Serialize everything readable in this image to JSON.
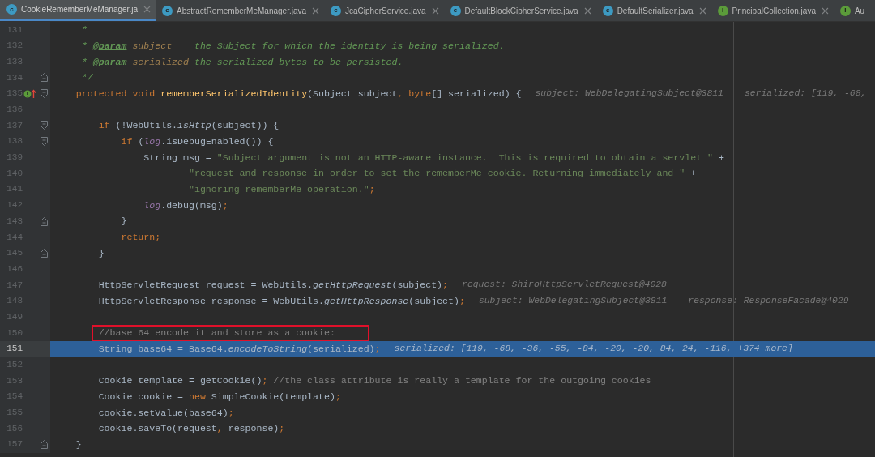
{
  "tabs": [
    {
      "label": "CookieRememberMeManager.ja",
      "kind": "class",
      "letter": "c",
      "selected": true
    },
    {
      "label": "AbstractRememberMeManager.java",
      "kind": "class",
      "letter": "c",
      "selected": false
    },
    {
      "label": "JcaCipherService.java",
      "kind": "class",
      "letter": "c",
      "selected": false
    },
    {
      "label": "DefaultBlockCipherService.java",
      "kind": "class",
      "letter": "c",
      "selected": false
    },
    {
      "label": "DefaultSerializer.java",
      "kind": "class",
      "letter": "c",
      "selected": false
    },
    {
      "label": "PrincipalCollection.java",
      "kind": "interface",
      "letter": "I",
      "selected": false
    },
    {
      "label": "Au",
      "kind": "interface",
      "letter": "I",
      "selected": false
    }
  ],
  "lines": [
    {
      "number": "131",
      "current": false,
      "boxed": false,
      "segments": [
        {
          "kind": "doc",
          "text": "     *"
        }
      ]
    },
    {
      "number": "132",
      "current": false,
      "boxed": false,
      "segments": [
        {
          "kind": "doc",
          "text": "     * "
        },
        {
          "kind": "doctag",
          "text": "@param"
        },
        {
          "kind": "docparam",
          "text": " subject"
        },
        {
          "kind": "doc",
          "text": "    the Subject for which the identity is being serialized."
        }
      ]
    },
    {
      "number": "133",
      "current": false,
      "boxed": false,
      "segments": [
        {
          "kind": "doc",
          "text": "     * "
        },
        {
          "kind": "doctag",
          "text": "@param"
        },
        {
          "kind": "docparam",
          "text": " serialized"
        },
        {
          "kind": "doc",
          "text": " the serialized bytes to be persisted."
        }
      ]
    },
    {
      "number": "134",
      "current": false,
      "boxed": false,
      "gutter": [
        {
          "kind": "fold-end"
        }
      ],
      "segments": [
        {
          "kind": "doc",
          "text": "     */"
        }
      ]
    },
    {
      "number": "135",
      "current": false,
      "boxed": false,
      "gutter": [
        {
          "kind": "implements"
        },
        {
          "kind": "fold-start"
        }
      ],
      "segments": [
        {
          "kind": "keyword",
          "text": "    protected void "
        },
        {
          "kind": "declaration",
          "text": "rememberSerializedIdentity"
        },
        {
          "kind": "plain",
          "text": "(Subject subject"
        },
        {
          "kind": "keyword",
          "text": ", byte"
        },
        {
          "kind": "plain",
          "text": "[] serialized) {"
        }
      ],
      "hints": [
        "subject: WebDelegatingSubject@3811",
        "serialized: [119, -68,"
      ]
    },
    {
      "number": "136",
      "current": false,
      "boxed": false
    },
    {
      "number": "137",
      "current": false,
      "boxed": false,
      "gutter": [
        {
          "kind": "fold-start"
        }
      ],
      "segments": [
        {
          "kind": "keyword",
          "text": "        if "
        },
        {
          "kind": "plain",
          "text": "(!WebUtils."
        },
        {
          "kind": "static",
          "text": "isHttp"
        },
        {
          "kind": "plain",
          "text": "(subject)) {"
        }
      ]
    },
    {
      "number": "138",
      "current": false,
      "boxed": false,
      "gutter": [
        {
          "kind": "fold-start"
        }
      ],
      "segments": [
        {
          "kind": "keyword",
          "text": "            if "
        },
        {
          "kind": "plain",
          "text": "("
        },
        {
          "kind": "field",
          "text": "log"
        },
        {
          "kind": "plain",
          "text": ".isDebugEnabled()) {"
        }
      ]
    },
    {
      "number": "139",
      "current": false,
      "boxed": false,
      "segments": [
        {
          "kind": "plain",
          "text": "                String msg = "
        },
        {
          "kind": "string",
          "text": "\"Subject argument is not an HTTP-aware instance.  This is required to obtain a servlet \""
        },
        {
          "kind": "plain",
          "text": " +"
        }
      ]
    },
    {
      "number": "140",
      "current": false,
      "boxed": false,
      "segments": [
        {
          "kind": "string",
          "text": "                        \"request and response in order to set the rememberMe cookie. Returning immediately and \""
        },
        {
          "kind": "plain",
          "text": " +"
        }
      ]
    },
    {
      "number": "141",
      "current": false,
      "boxed": false,
      "segments": [
        {
          "kind": "string",
          "text": "                        \"ignoring rememberMe operation.\""
        },
        {
          "kind": "keyword",
          "text": ";"
        }
      ]
    },
    {
      "number": "142",
      "current": false,
      "boxed": false,
      "segments": [
        {
          "kind": "field",
          "text": "                log"
        },
        {
          "kind": "plain",
          "text": ".debug(msg)"
        },
        {
          "kind": "keyword",
          "text": ";"
        }
      ]
    },
    {
      "number": "143",
      "current": false,
      "boxed": false,
      "gutter": [
        {
          "kind": "fold-end"
        }
      ],
      "segments": [
        {
          "kind": "plain",
          "text": "            }"
        }
      ]
    },
    {
      "number": "144",
      "current": false,
      "boxed": false,
      "segments": [
        {
          "kind": "keyword",
          "text": "            return;"
        }
      ]
    },
    {
      "number": "145",
      "current": false,
      "boxed": false,
      "gutter": [
        {
          "kind": "fold-end"
        }
      ],
      "segments": [
        {
          "kind": "plain",
          "text": "        }"
        }
      ]
    },
    {
      "number": "146",
      "current": false,
      "boxed": false
    },
    {
      "number": "147",
      "current": false,
      "boxed": false,
      "segments": [
        {
          "kind": "plain",
          "text": "        HttpServletRequest request = WebUtils."
        },
        {
          "kind": "static",
          "text": "getHttpRequest"
        },
        {
          "kind": "plain",
          "text": "(subject)"
        },
        {
          "kind": "keyword",
          "text": ";"
        }
      ],
      "hints": [
        "request: ShiroHttpServletRequest@4028"
      ]
    },
    {
      "number": "148",
      "current": false,
      "boxed": false,
      "segments": [
        {
          "kind": "plain",
          "text": "        HttpServletResponse response = WebUtils."
        },
        {
          "kind": "static",
          "text": "getHttpResponse"
        },
        {
          "kind": "plain",
          "text": "(subject)"
        },
        {
          "kind": "keyword",
          "text": ";"
        }
      ],
      "hints": [
        "subject: WebDelegatingSubject@3811",
        "response: ResponseFacade@4029"
      ]
    },
    {
      "number": "149",
      "current": false,
      "boxed": false
    },
    {
      "number": "150",
      "current": false,
      "boxed": true,
      "segments": [
        {
          "kind": "comment",
          "text": "        //base 64 encode it and store as a cookie:"
        }
      ]
    },
    {
      "number": "151",
      "current": true,
      "boxed": false,
      "segments": [
        {
          "kind": "plain",
          "text": "        String base64 = Base64."
        },
        {
          "kind": "static",
          "text": "encodeToString"
        },
        {
          "kind": "plain",
          "text": "(serialized)"
        },
        {
          "kind": "keyword",
          "text": ";"
        }
      ],
      "hints": [
        "serialized: [119, -68, -36, -55, -84, -20, -20, 84, 24, -116, +374 more]"
      ]
    },
    {
      "number": "152",
      "current": false,
      "boxed": false
    },
    {
      "number": "153",
      "current": false,
      "boxed": false,
      "segments": [
        {
          "kind": "plain",
          "text": "        Cookie template = getCookie()"
        },
        {
          "kind": "keyword",
          "text": ";"
        },
        {
          "kind": "comment",
          "text": " //the class attribute is really a template for the outgoing cookies"
        }
      ]
    },
    {
      "number": "154",
      "current": false,
      "boxed": false,
      "segments": [
        {
          "kind": "plain",
          "text": "        Cookie cookie = "
        },
        {
          "kind": "keyword",
          "text": "new "
        },
        {
          "kind": "plain",
          "text": "SimpleCookie(template)"
        },
        {
          "kind": "keyword",
          "text": ";"
        }
      ]
    },
    {
      "number": "155",
      "current": false,
      "boxed": false,
      "segments": [
        {
          "kind": "plain",
          "text": "        cookie.setValue(base64)"
        },
        {
          "kind": "keyword",
          "text": ";"
        }
      ]
    },
    {
      "number": "156",
      "current": false,
      "boxed": false,
      "segments": [
        {
          "kind": "plain",
          "text": "        cookie.saveTo(request"
        },
        {
          "kind": "keyword",
          "text": ", "
        },
        {
          "kind": "plain",
          "text": "response)"
        },
        {
          "kind": "keyword",
          "text": ";"
        }
      ]
    },
    {
      "number": "157",
      "current": false,
      "boxed": false,
      "gutter": [
        {
          "kind": "fold-end"
        }
      ],
      "segments": [
        {
          "kind": "plain",
          "text": "    }"
        }
      ]
    }
  ]
}
